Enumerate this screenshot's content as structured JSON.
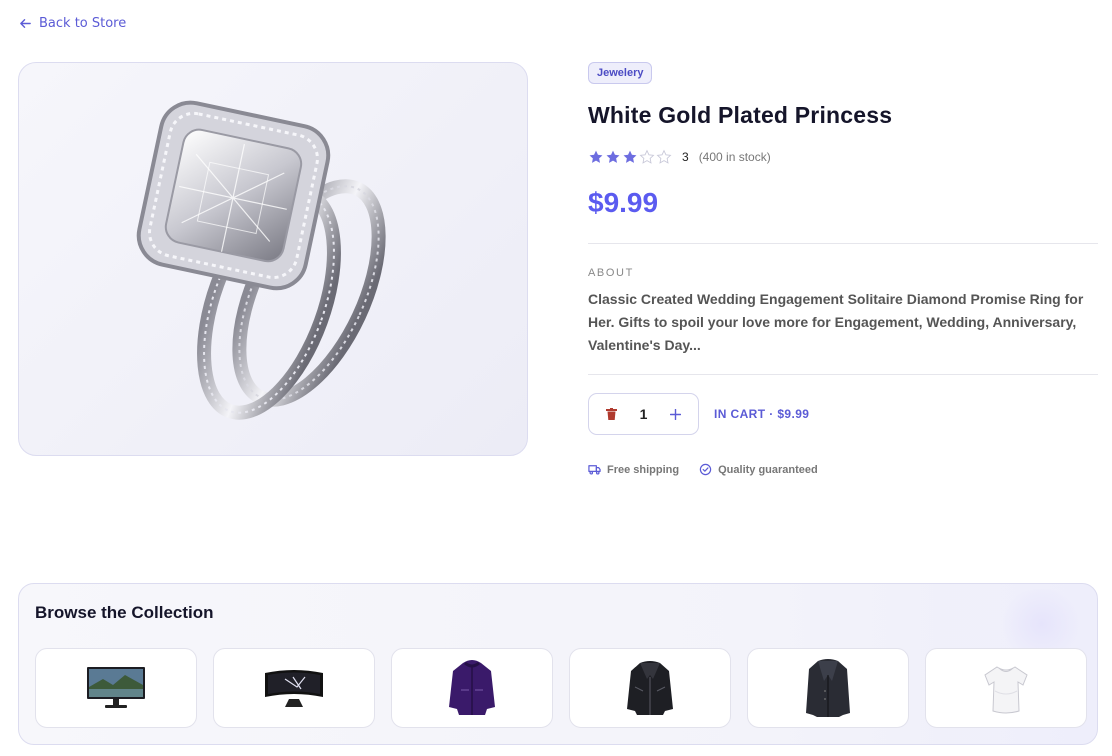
{
  "nav": {
    "back_label": "Back to Store",
    "back_icon": "arrow-left-icon"
  },
  "product": {
    "category": "Jewelery",
    "title": "White Gold Plated Princess",
    "rating": 3,
    "rating_max": 5,
    "rating_label": "3",
    "stock_label": "(400 in stock)",
    "price": "$9.99",
    "about_label": "ABOUT",
    "about_text": "Classic Created Wedding Engagement Solitaire Diamond Promise Ring for Her. Gifts to spoil your love more for Engagement, Wedding, Anniversary, Valentine's Day..."
  },
  "cart": {
    "quantity": "1",
    "status": "IN CART · $9.99",
    "remove_icon": "trash-icon",
    "add_icon": "plus-icon"
  },
  "perks": [
    {
      "label": "Free shipping",
      "icon": "truck-icon"
    },
    {
      "label": "Quality guaranteed",
      "icon": "badge-check-icon"
    }
  ],
  "collection": {
    "title": "Browse the Collection",
    "items": [
      {
        "name": "monitor"
      },
      {
        "name": "curved-monitor"
      },
      {
        "name": "purple-jacket"
      },
      {
        "name": "leather-jacket"
      },
      {
        "name": "dark-coat"
      },
      {
        "name": "white-tshirt"
      }
    ]
  },
  "colors": {
    "accent": "#5b5bf0",
    "star": "#6d6de0",
    "trash": "#b03a2e"
  }
}
